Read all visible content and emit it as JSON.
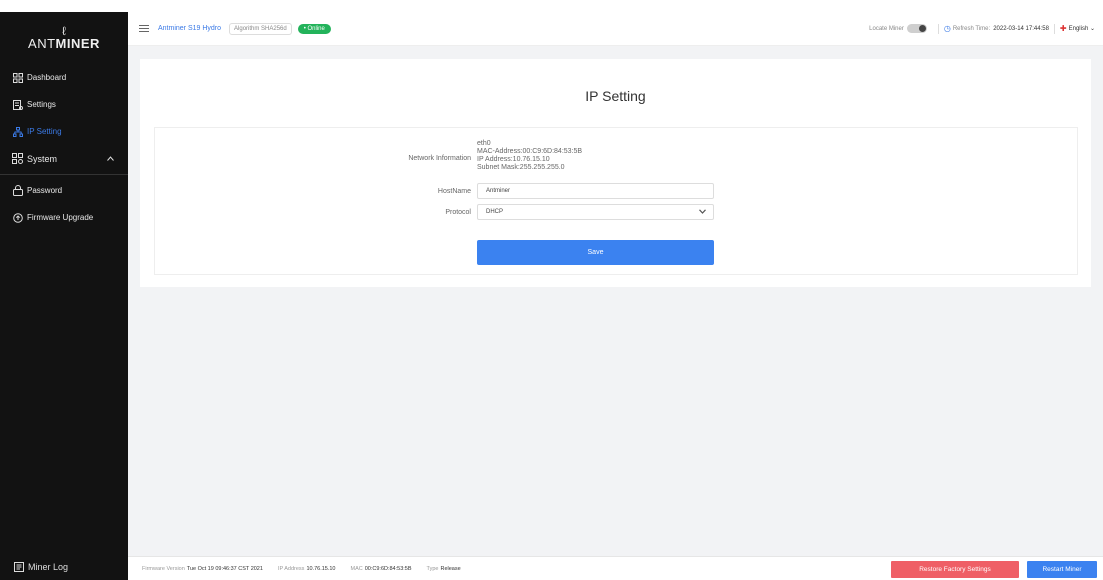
{
  "sidebar": {
    "logo_mark": "ℓ",
    "logo_text_light": "ANT",
    "logo_text_bold": "MINER",
    "items": [
      {
        "label": "Dashboard",
        "icon": "grid-icon"
      },
      {
        "label": "Settings",
        "icon": "settings-icon"
      },
      {
        "label": "IP Setting",
        "icon": "network-icon",
        "active": true
      },
      {
        "label": "System",
        "icon": "system-icon",
        "expanded": true
      },
      {
        "label": "Password",
        "icon": "lock-icon"
      },
      {
        "label": "Firmware Upgrade",
        "icon": "upgrade-icon"
      }
    ],
    "miner_log": "Miner Log"
  },
  "header": {
    "model": "Antminer S19 Hydro",
    "algorithm": "Algorithm SHA256d",
    "status": "• Online",
    "locate_miner": "Locate Miner",
    "refresh_label": "Refresh Time:",
    "refresh_time": "2022-03-14 17:44:58",
    "language": "English ⌄"
  },
  "ip_setting": {
    "title": "IP Setting",
    "network_label": "Network Information",
    "network_lines": [
      "eth0",
      "MAC-Address:00:C9:6D:84:53:5B",
      "IP Address:10.76.15.10",
      "Subnet Mask:255.255.255.0"
    ],
    "hostname_label": "HostName",
    "hostname_value": "Antminer",
    "protocol_label": "Protocol",
    "protocol_value": "DHCP",
    "save_label": "Save"
  },
  "footer": {
    "firmware_label": "Firmware Version",
    "firmware_value": "Tue Oct 19 09:46:37 CST 2021",
    "ip_label": "IP Address",
    "ip_value": "10.76.15.10",
    "mac_label": "MAC",
    "mac_value": "00:C9:6D:84:53:5B",
    "type_label": "Type",
    "type_value": "Release",
    "restore_label": "Restore Factory Settings",
    "restart_label": "Restart Miner"
  },
  "colors": {
    "sidebar_bg": "#121212",
    "accent": "#3b82f0",
    "online": "#23b35b",
    "danger": "#ef5f66"
  }
}
